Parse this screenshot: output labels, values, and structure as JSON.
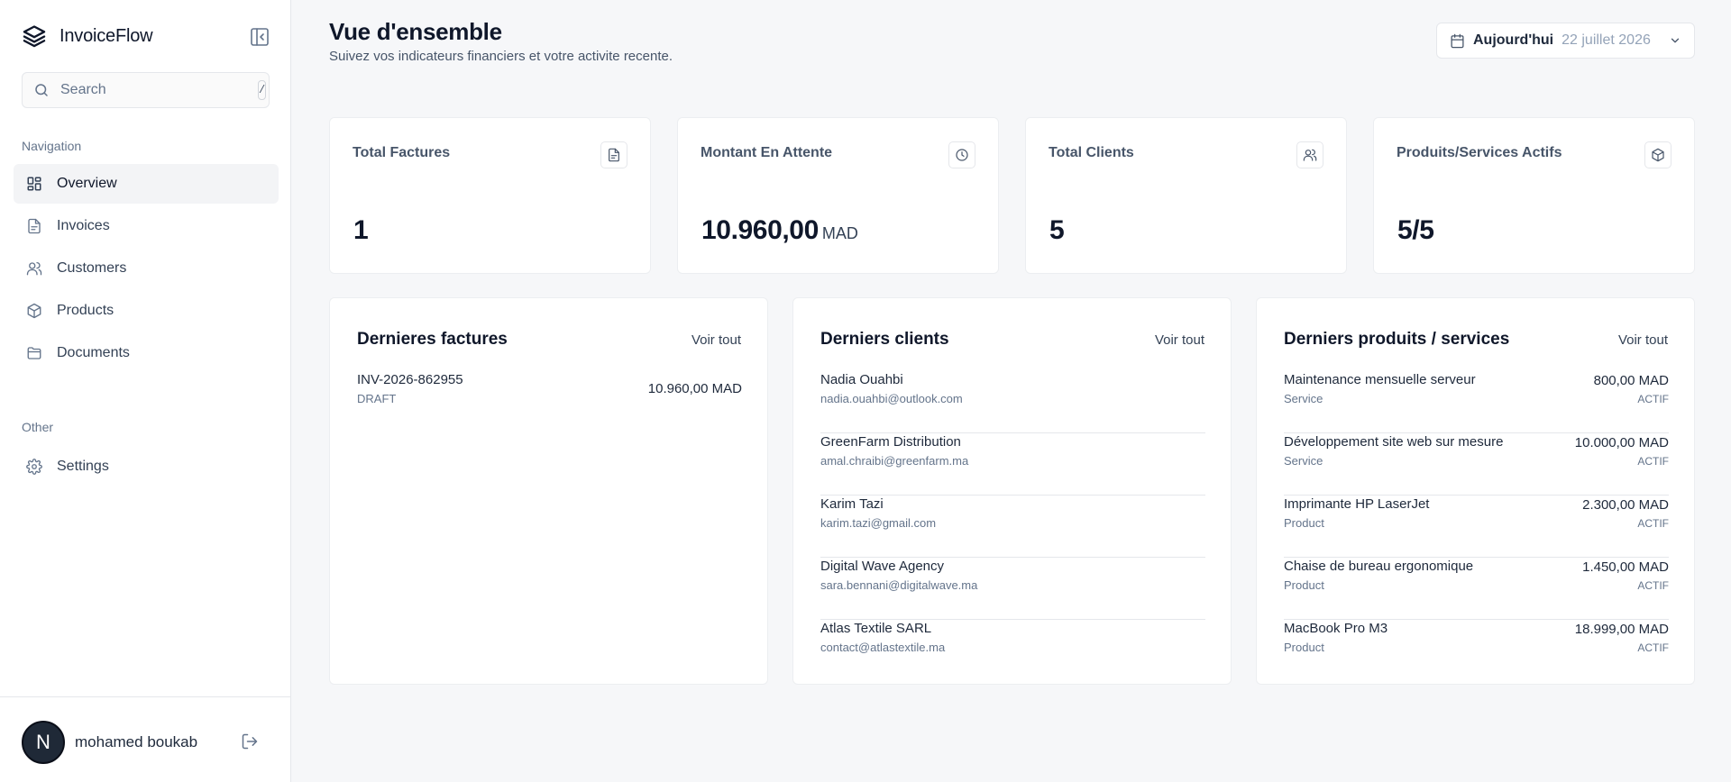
{
  "app": {
    "name": "InvoiceFlow"
  },
  "search": {
    "placeholder": "Search",
    "shortcut": "/"
  },
  "nav": {
    "section_label": "Navigation",
    "items": [
      {
        "label": "Overview",
        "icon": "layout-grid-icon",
        "active": true
      },
      {
        "label": "Invoices",
        "icon": "file-icon"
      },
      {
        "label": "Customers",
        "icon": "users-icon"
      },
      {
        "label": "Products",
        "icon": "box-icon"
      },
      {
        "label": "Documents",
        "icon": "folder-icon"
      }
    ]
  },
  "other": {
    "section_label": "Other",
    "items": [
      {
        "label": "Settings",
        "icon": "gear-icon"
      }
    ]
  },
  "user": {
    "initial": "N",
    "name": "mohamed boukab"
  },
  "header": {
    "title": "Vue d'ensemble",
    "subtitle": "Suivez vos indicateurs financiers et votre activite recente.",
    "date_label": "Aujourd'hui",
    "date_value": "22 juillet 2026"
  },
  "stats": [
    {
      "title": "Total Factures",
      "value": "1",
      "unit": "",
      "icon": "file-icon"
    },
    {
      "title": "Montant En Attente",
      "value": "10.960,00",
      "unit": "MAD",
      "icon": "clock-icon"
    },
    {
      "title": "Total Clients",
      "value": "5",
      "unit": "",
      "icon": "users-icon"
    },
    {
      "title": "Produits/Services Actifs",
      "value": "5/5",
      "unit": "",
      "icon": "box-icon"
    }
  ],
  "invoices_panel": {
    "title": "Dernieres factures",
    "link": "Voir tout",
    "rows": [
      {
        "number": "INV-2026-862955",
        "status": "DRAFT",
        "amount": "10.960,00 MAD"
      }
    ]
  },
  "clients_panel": {
    "title": "Derniers clients",
    "link": "Voir tout",
    "rows": [
      {
        "name": "Nadia Ouahbi",
        "email": "nadia.ouahbi@outlook.com"
      },
      {
        "name": "GreenFarm Distribution",
        "email": "amal.chraibi@greenfarm.ma"
      },
      {
        "name": "Karim Tazi",
        "email": "karim.tazi@gmail.com"
      },
      {
        "name": "Digital Wave Agency",
        "email": "sara.bennani@digitalwave.ma"
      },
      {
        "name": "Atlas Textile SARL",
        "email": "contact@atlastextile.ma"
      }
    ]
  },
  "products_panel": {
    "title": "Derniers produits / services",
    "link": "Voir tout",
    "rows": [
      {
        "name": "Maintenance mensuelle serveur",
        "type": "Service",
        "price": "800,00 MAD",
        "status": "ACTIF"
      },
      {
        "name": "Développement site web sur mesure",
        "type": "Service",
        "price": "10.000,00 MAD",
        "status": "ACTIF"
      },
      {
        "name": "Imprimante HP LaserJet",
        "type": "Product",
        "price": "2.300,00 MAD",
        "status": "ACTIF"
      },
      {
        "name": "Chaise de bureau ergonomique",
        "type": "Product",
        "price": "1.450,00 MAD",
        "status": "ACTIF"
      },
      {
        "name": "MacBook Pro M3",
        "type": "Product",
        "price": "18.999,00 MAD",
        "status": "ACTIF"
      }
    ]
  }
}
